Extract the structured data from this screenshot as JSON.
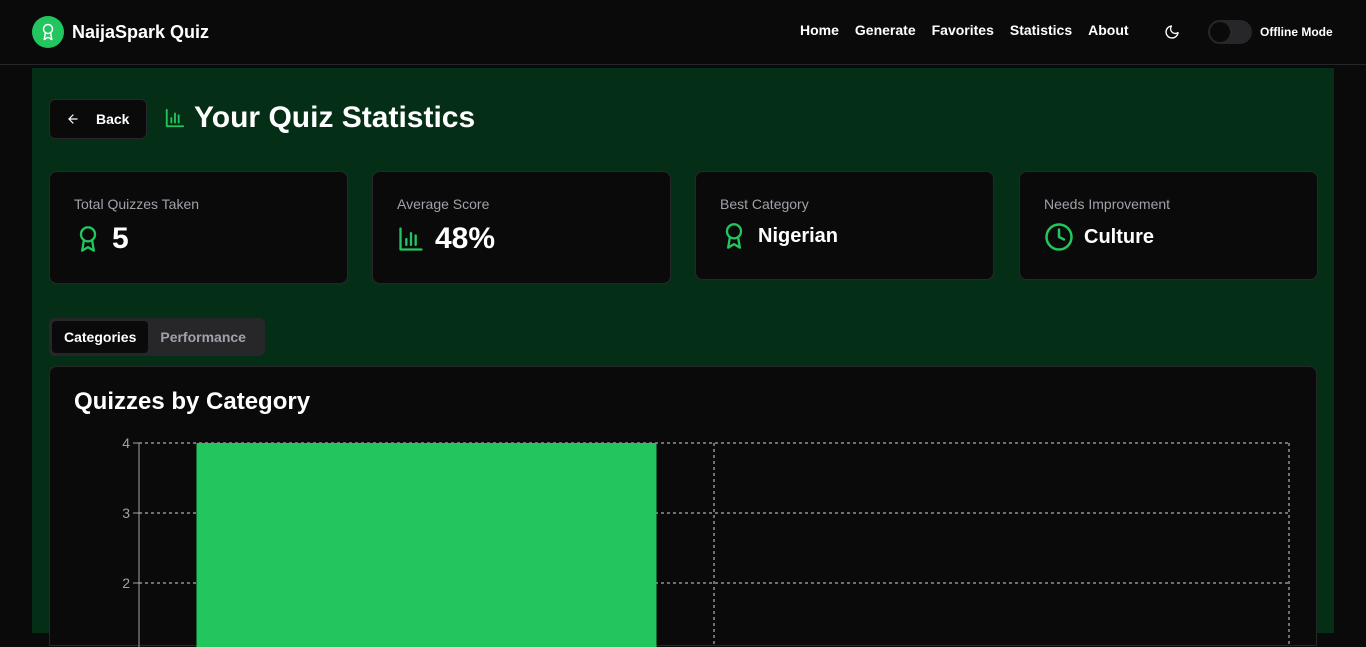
{
  "app": {
    "name": "NaijaSpark Quiz"
  },
  "nav": {
    "items": [
      "Home",
      "Generate",
      "Favorites",
      "Statistics",
      "About"
    ],
    "offline_label": "Offline Mode"
  },
  "page": {
    "back_label": "Back",
    "title": "Your Quiz Statistics"
  },
  "stats": [
    {
      "label": "Total Quizzes Taken",
      "value": "5",
      "icon": "award-icon"
    },
    {
      "label": "Average Score",
      "value": "48%",
      "icon": "bar-chart-icon"
    },
    {
      "label": "Best Category",
      "value": "Nigerian",
      "icon": "award-icon"
    },
    {
      "label": "Needs Improvement",
      "value": "Culture",
      "icon": "clock-icon"
    }
  ],
  "tabs": [
    "Categories",
    "Performance"
  ],
  "chart_title": "Quizzes by Category",
  "colors": {
    "accent": "#22c55e",
    "background": "#0a0a0a",
    "main_bg": "#052e16"
  },
  "chart_data": {
    "type": "bar",
    "title": "Quizzes by Category",
    "categories": [
      "",
      ""
    ],
    "values": [
      4,
      null
    ],
    "y_ticks": [
      2,
      3,
      4
    ],
    "ylim": [
      0,
      4
    ],
    "grid": true
  }
}
